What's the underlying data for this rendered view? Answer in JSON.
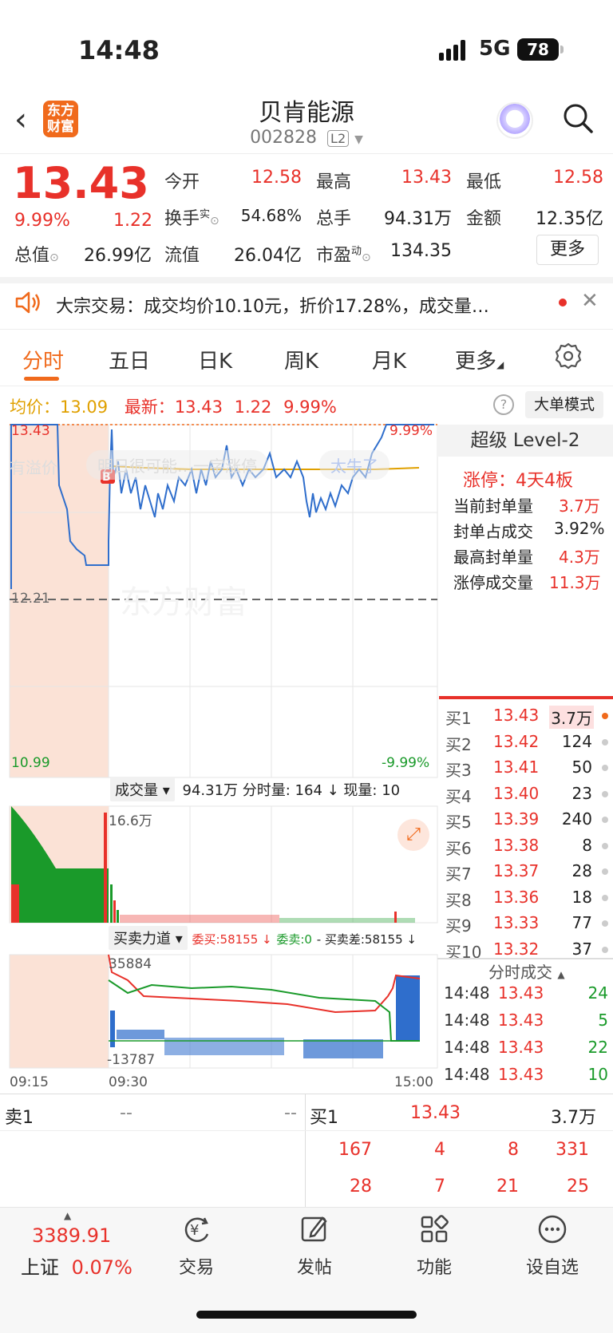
{
  "status_bar": {
    "time": "14:48",
    "network": "5G",
    "battery": "78"
  },
  "header": {
    "logo": "东方\n财富",
    "stock_name": "贝肯能源",
    "stock_code": "002828",
    "badge": "L2"
  },
  "quote": {
    "price": "13.43",
    "pct": "9.99%",
    "change": "1.22",
    "open_label": "今开",
    "open": "12.58",
    "high_label": "最高",
    "high": "13.43",
    "low_label": "最低",
    "low": "12.58",
    "turnover_label": "换手",
    "turnover_sup": "实",
    "turnover": "54.68%",
    "volume_label": "总手",
    "volume": "94.31万",
    "amount_label": "金额",
    "amount": "12.35亿",
    "mktcap_label": "总值",
    "mktcap": "26.99亿",
    "float_label": "流值",
    "float": "26.04亿",
    "pe_label": "市盈",
    "pe_sup": "动",
    "pe": "134.35",
    "more": "更多"
  },
  "notice": {
    "text": "大宗交易：成交均价10.10元，折价17.28%，成交量…"
  },
  "tabs": [
    "分时",
    "五日",
    "日K",
    "周K",
    "月K",
    "更多"
  ],
  "info_line": {
    "avg_label": "均价：",
    "avg": "13.09",
    "latest_label": "最新：",
    "latest": "13.43",
    "change": "1.22",
    "pct": "9.99%",
    "big_order": "大单模式"
  },
  "chart": {
    "top_price": "13.43",
    "top_pct": "9.99%",
    "mid_price": "12.21",
    "bottom_price": "10.99",
    "bottom_pct": "-9.99%",
    "overlay_left": "有溢价",
    "overlay_mid": "明日很可能…一字涨停",
    "overlay_right": "太牛了",
    "b_marker": "B",
    "watermark": "东方财富",
    "vol_dropdown": "成交量",
    "vol_info": "94.31万 分时量: 164 ↓ 现量: 10",
    "vol_max": "16.6万",
    "force_dropdown": "买卖力道",
    "force_buy": "委买:58155 ↓",
    "force_sell": "委卖:0",
    "force_diff": "- 买卖差:58155 ↓",
    "force_max": "35884",
    "force_min": "-13787",
    "time_start": "09:15",
    "time_open": "09:30",
    "time_end": "15:00"
  },
  "chart_data": {
    "type": "line",
    "title": "",
    "series": [
      {
        "name": "最新",
        "color": "#2f6ecc"
      },
      {
        "name": "均价",
        "color": "#e0a000"
      }
    ],
    "ylim": [
      10.99,
      13.43
    ],
    "reference": 12.21,
    "x_ticks": [
      "09:15",
      "09:30",
      "15:00"
    ]
  },
  "level2": {
    "title": "超级 Level-2",
    "limit_up": "涨停：4天4板",
    "rows": [
      {
        "label": "当前封单量",
        "value": "3.7万"
      },
      {
        "label": "封单占成交",
        "value": "3.92%"
      },
      {
        "label": "最高封单量",
        "value": "4.3万"
      },
      {
        "label": "涨停成交量",
        "value": "11.3万"
      }
    ]
  },
  "bids": [
    {
      "label": "买1",
      "price": "13.43",
      "vol": "3.7万"
    },
    {
      "label": "买2",
      "price": "13.42",
      "vol": "124"
    },
    {
      "label": "买3",
      "price": "13.41",
      "vol": "50"
    },
    {
      "label": "买4",
      "price": "13.40",
      "vol": "23"
    },
    {
      "label": "买5",
      "price": "13.39",
      "vol": "240"
    },
    {
      "label": "买6",
      "price": "13.38",
      "vol": "8"
    },
    {
      "label": "买7",
      "price": "13.37",
      "vol": "28"
    },
    {
      "label": "买8",
      "price": "13.36",
      "vol": "18"
    },
    {
      "label": "买9",
      "price": "13.33",
      "vol": "77"
    },
    {
      "label": "买10",
      "price": "13.32",
      "vol": "37"
    }
  ],
  "ticks_title": "分时成交",
  "ticks": [
    {
      "time": "14:48",
      "price": "13.43",
      "vol": "24"
    },
    {
      "time": "14:48",
      "price": "13.43",
      "vol": "5"
    },
    {
      "time": "14:48",
      "price": "13.43",
      "vol": "22"
    },
    {
      "time": "14:48",
      "price": "13.43",
      "vol": "10"
    }
  ],
  "order_table": {
    "sell_label": "卖1",
    "sell_vals": [
      "--",
      "--"
    ],
    "buy_label": "买1",
    "buy_price": "13.43",
    "buy_vol": "3.7万",
    "queue_row1": [
      "167",
      "4",
      "8",
      "331"
    ],
    "queue_row2": [
      "28",
      "7",
      "21",
      "25"
    ]
  },
  "bottom_nav": {
    "index_value": "3389.91",
    "index_name": "上证",
    "index_pct": "0.07%",
    "items": [
      "交易",
      "发帖",
      "功能",
      "设自选"
    ]
  }
}
